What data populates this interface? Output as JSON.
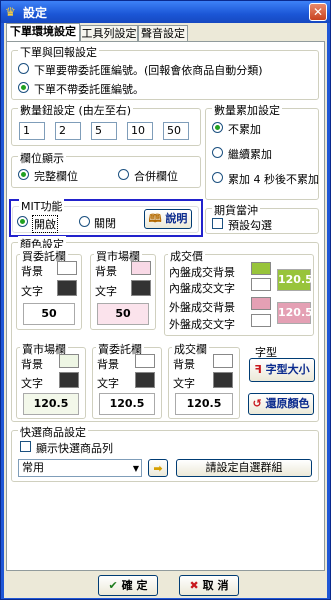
{
  "window": {
    "title": "設定",
    "close_glyph": "✕",
    "app_glyph": "♛"
  },
  "tabs": [
    "下單環境設定",
    "工具列設定",
    "聲音設定"
  ],
  "order_group": {
    "title": "下單與回報設定",
    "opt1": "下單要帶委託匯編號。(回報會依商品自動分類)",
    "opt2": "下單不帶委託匯編號。"
  },
  "qty_btn": {
    "title": "數量鈕設定 (由左至右)",
    "values": [
      "1",
      "2",
      "5",
      "10",
      "50"
    ]
  },
  "qty_accum": {
    "title": "數量累加設定",
    "opts": [
      "不累加",
      "繼續累加",
      "累加 4 秒後不累加"
    ]
  },
  "column_display": {
    "title": "欄位顯示",
    "opts": [
      "完整欄位",
      "合併欄位"
    ]
  },
  "mit": {
    "title": "MIT功能",
    "open": "開啟",
    "close": "關閉",
    "help": "說明"
  },
  "hedge": {
    "title": "期貨當沖",
    "label": "預設勾選"
  },
  "color": {
    "title": "顏色設定",
    "buy_order": {
      "title": "買委託欄",
      "bg": "背景",
      "fg": "文字",
      "value": "50"
    },
    "buy_market": {
      "title": "買市場欄",
      "bg": "背景",
      "fg": "文字",
      "value": "50"
    },
    "trade_price": {
      "title": "成交價",
      "in_bg": "內盤成交背景",
      "in_fg": "內盤成交文字",
      "out_bg": "外盤成交背景",
      "out_fg": "外盤成交文字",
      "in_value": "120.5",
      "out_value": "120.5"
    },
    "sell_market": {
      "title": "賣市場欄",
      "bg": "背景",
      "fg": "文字",
      "value": "120.5"
    },
    "sell_order": {
      "title": "賣委託欄",
      "bg": "背景",
      "fg": "文字",
      "value": "120.5"
    },
    "trade_col": {
      "title": "成交欄",
      "bg": "背景",
      "fg": "文字",
      "value": "120.5"
    },
    "font": {
      "title": "字型",
      "button": "字型大小"
    },
    "reset": "還原顏色",
    "colors": {
      "buy_order_bg": "#ffffff",
      "buy_order_fg": "#333333",
      "buy_market_bg": "#f9d9e6",
      "buy_market_fg": "#333333",
      "in_bg": "#98c43b",
      "in_fg": "#ffffff",
      "out_bg": "#e4a0b4",
      "out_fg": "#ffffff",
      "sell_market_bg": "#eef6e4",
      "sell_market_fg": "#333333",
      "sell_order_bg": "#ffffff",
      "sell_order_fg": "#333333",
      "trade_bg": "#ffffff",
      "trade_fg": "#333333"
    }
  },
  "quick": {
    "title": "快選商品設定",
    "show": "顯示快選商品列",
    "select": "常用",
    "group_btn": "請設定自選群組"
  },
  "footer": {
    "ok": "確 定",
    "cancel": "取 消"
  }
}
